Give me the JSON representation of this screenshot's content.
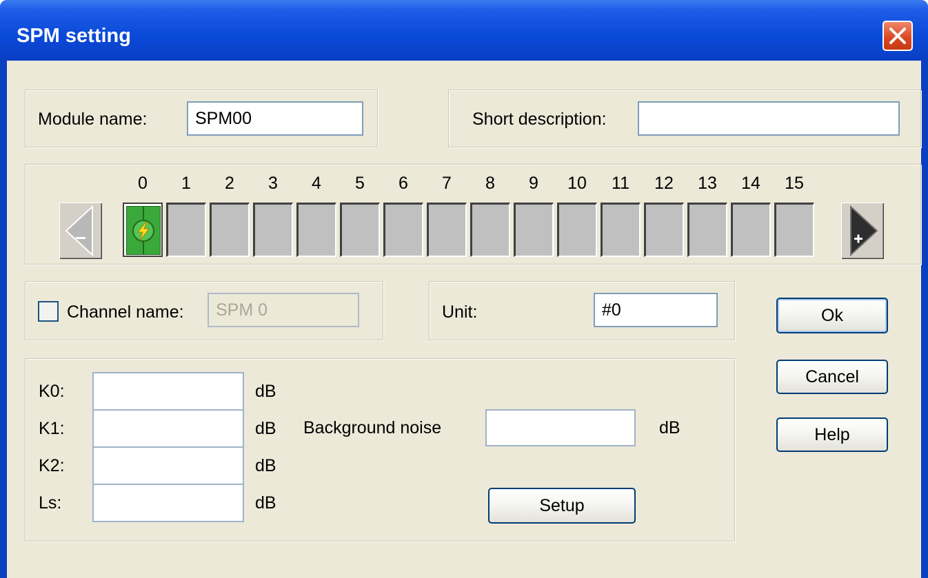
{
  "window": {
    "title": "SPM setting"
  },
  "module": {
    "name_label": "Module name:",
    "name_value": "SPM00",
    "desc_label": "Short description:",
    "desc_value": ""
  },
  "channels": {
    "numbers": [
      "0",
      "1",
      "2",
      "3",
      "4",
      "5",
      "6",
      "7",
      "8",
      "9",
      "10",
      "11",
      "12",
      "13",
      "14",
      "15"
    ],
    "active_index": 0,
    "prev_button": "-",
    "next_button": "+"
  },
  "channel": {
    "checkbox_label": "Channel name:",
    "checked": false,
    "name_value": "SPM 0"
  },
  "unit": {
    "label": "Unit:",
    "value": "#0"
  },
  "params": [
    {
      "label": "K0:",
      "value": "",
      "unit": "dB"
    },
    {
      "label": "K1:",
      "value": "",
      "unit": "dB"
    },
    {
      "label": "K2:",
      "value": "",
      "unit": "dB"
    },
    {
      "label": "Ls:",
      "value": "",
      "unit": "dB"
    }
  ],
  "background_noise": {
    "label": "Background noise",
    "value": "",
    "unit": "dB"
  },
  "buttons": {
    "setup": "Setup",
    "ok": "Ok",
    "cancel": "Cancel",
    "help": "Help"
  },
  "colors": {
    "title_bar": "#0a49d8",
    "dialog_bg": "#ece9d8",
    "active_channel": "#3aa83a",
    "close_button": "#d9451f"
  }
}
